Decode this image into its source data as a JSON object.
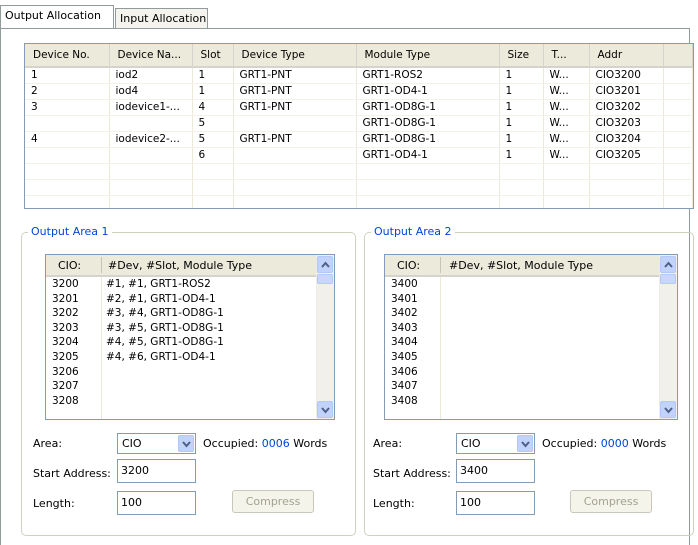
{
  "tabs": [
    {
      "label": "Output Allocation",
      "active": true
    },
    {
      "label": "Input Allocation",
      "active": false
    }
  ],
  "table": {
    "columns": [
      "Device No.",
      "Device Na...",
      "Slot",
      "Device Type",
      "Module Type",
      "Size",
      "T...",
      "Addr"
    ],
    "rows": [
      [
        "1",
        "iod2",
        "1",
        "GRT1-PNT",
        "GRT1-ROS2",
        "1",
        "W...",
        "CIO3200"
      ],
      [
        "2",
        "iod4",
        "1",
        "GRT1-PNT",
        "GRT1-OD4-1",
        "1",
        "W...",
        "CIO3201"
      ],
      [
        "3",
        "iodevice1-...",
        "4",
        "GRT1-PNT",
        "GRT1-OD8G-1",
        "1",
        "W...",
        "CIO3202"
      ],
      [
        "",
        "",
        "5",
        "",
        "GRT1-OD8G-1",
        "1",
        "W...",
        "CIO3203"
      ],
      [
        "4",
        "iodevice2-...",
        "5",
        "GRT1-PNT",
        "GRT1-OD8G-1",
        "1",
        "W...",
        "CIO3204"
      ],
      [
        "",
        "",
        "6",
        "",
        "GRT1-OD4-1",
        "1",
        "W...",
        "CIO3205"
      ]
    ]
  },
  "area1": {
    "title": "Output Area 1",
    "list_headers": [
      "CIO:",
      "#Dev, #Slot, Module Type"
    ],
    "rows": [
      {
        "cio": "3200",
        "desc": "#1,  #1,  GRT1-ROS2"
      },
      {
        "cio": "3201",
        "desc": "#2,  #1,  GRT1-OD4-1"
      },
      {
        "cio": "3202",
        "desc": "#3,  #4,  GRT1-OD8G-1"
      },
      {
        "cio": "3203",
        "desc": "#3,  #5,  GRT1-OD8G-1"
      },
      {
        "cio": "3204",
        "desc": "#4,  #5,  GRT1-OD8G-1"
      },
      {
        "cio": "3205",
        "desc": "#4,  #6,  GRT1-OD4-1"
      },
      {
        "cio": "3206",
        "desc": ""
      },
      {
        "cio": "3207",
        "desc": ""
      },
      {
        "cio": "3208",
        "desc": ""
      }
    ],
    "area_label": "Area:",
    "area_value": "CIO",
    "occupied_label": "Occupied:",
    "occupied_value": "0006",
    "occupied_unit": "Words",
    "start_label": "Start Address:",
    "start_value": "3200",
    "length_label": "Length:",
    "length_value": "100",
    "compress_label": "Compress"
  },
  "area2": {
    "title": "Output Area 2",
    "list_headers": [
      "CIO:",
      "#Dev, #Slot, Module Type"
    ],
    "rows": [
      {
        "cio": "3400",
        "desc": ""
      },
      {
        "cio": "3401",
        "desc": ""
      },
      {
        "cio": "3402",
        "desc": ""
      },
      {
        "cio": "3403",
        "desc": ""
      },
      {
        "cio": "3404",
        "desc": ""
      },
      {
        "cio": "3405",
        "desc": ""
      },
      {
        "cio": "3406",
        "desc": ""
      },
      {
        "cio": "3407",
        "desc": ""
      },
      {
        "cio": "3408",
        "desc": ""
      }
    ],
    "area_label": "Area:",
    "area_value": "CIO",
    "occupied_label": "Occupied:",
    "occupied_value": "0000",
    "occupied_unit": "Words",
    "start_label": "Start Address:",
    "start_value": "3400",
    "length_label": "Length:",
    "length_value": "100",
    "compress_label": "Compress"
  },
  "icons": {
    "scroll_up": "chevron-up-icon",
    "scroll_down": "chevron-down-icon",
    "dropdown": "chevron-down-icon"
  },
  "colors": {
    "accent": "#0046d5",
    "border": "#7f9db9",
    "header_bg": "#ebeadb",
    "disabled_text": "#a3a28f"
  }
}
